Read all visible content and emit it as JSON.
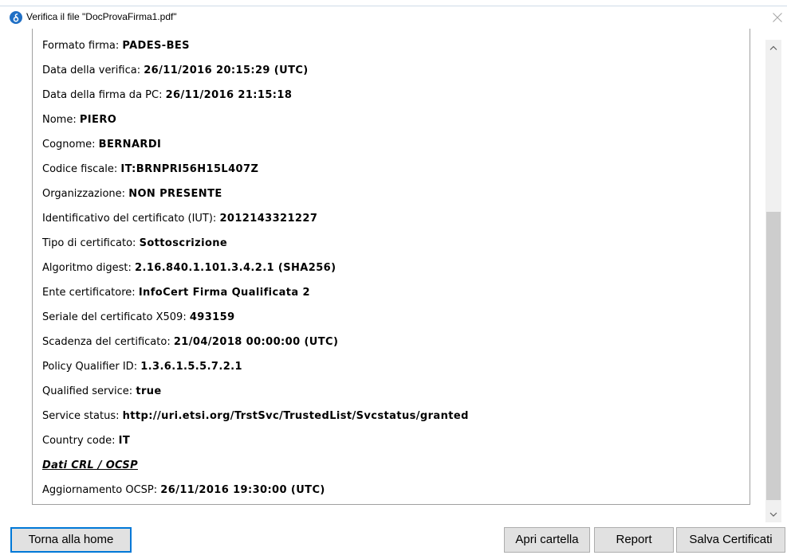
{
  "window": {
    "title": "Verifica il file \"DocProvaFirma1.pdf\"",
    "app_icon": "app-logo-icon",
    "close_icon": "close-icon"
  },
  "colors": {
    "focus_accent": "#0078d7",
    "app_icon": "#1f6fc5"
  },
  "details": {
    "rows": [
      {
        "label": "Formato firma:",
        "value": "PADES-BES"
      },
      {
        "label": "Data della verifica:",
        "value": "26/11/2016 20:15:29 (UTC)"
      },
      {
        "label": "Data della firma da PC:",
        "value": "26/11/2016 21:15:18"
      },
      {
        "label": "Nome:",
        "value": "PIERO"
      },
      {
        "label": "Cognome:",
        "value": "BERNARDI"
      },
      {
        "label": "Codice fiscale:",
        "value": "IT:BRNPRI56H15L407Z"
      },
      {
        "label": "Organizzazione:",
        "value": "NON PRESENTE"
      },
      {
        "label": "Identificativo del certificato (IUT):",
        "value": "2012143321227"
      },
      {
        "label": "Tipo di certificato:",
        "value": "Sottoscrizione"
      },
      {
        "label": "Algoritmo digest:",
        "value": "2.16.840.1.101.3.4.2.1 (SHA256)"
      },
      {
        "label": "Ente certificatore:",
        "value": "InfoCert Firma Qualificata 2"
      },
      {
        "label": "Seriale del certificato X509:",
        "value": "493159"
      },
      {
        "label": "Scadenza del certificato:",
        "value": "21/04/2018 00:00:00 (UTC)"
      },
      {
        "label": "Policy Qualifier ID:",
        "value": "1.3.6.1.5.5.7.2.1"
      },
      {
        "label": "Qualified service:",
        "value": "true"
      },
      {
        "label": "Service status:",
        "value": "http://uri.etsi.org/TrstSvc/TrustedList/Svcstatus/granted"
      },
      {
        "label": "Country code:",
        "value": "IT"
      }
    ]
  },
  "crl_ocsp": {
    "heading": "Dati CRL / OCSP",
    "rows": [
      {
        "label": "Aggiornamento OCSP:",
        "value": "26/11/2016 19:30:00 (UTC)"
      }
    ]
  },
  "scrollbar": {
    "up_icon": "chevron-up-icon",
    "down_icon": "chevron-down-icon",
    "scroll_position": 0.96,
    "visible_portion": 0.64
  },
  "buttons": {
    "home": "Torna alla home",
    "open_folder": "Apri cartella",
    "report": "Report",
    "save_certificates": "Salva Certificati"
  }
}
